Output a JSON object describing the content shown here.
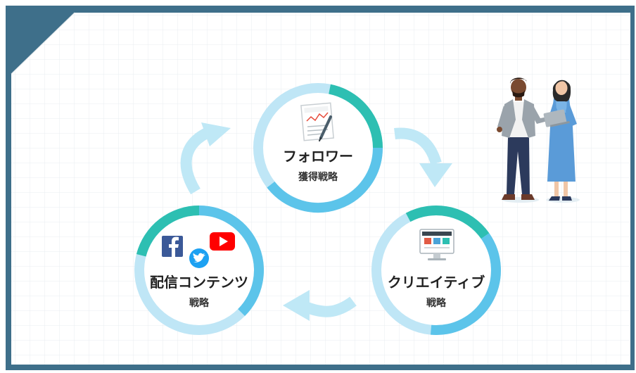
{
  "colors": {
    "teal": "#2dbfb2",
    "blue": "#5cc4ea",
    "light_blue": "#bfe6f6",
    "arrow": "#bfe8f6",
    "frame": "#3e6f8a",
    "grid": "#e9eef1"
  },
  "cycle": {
    "follower": {
      "title": "フォロワー",
      "subtitle": "獲得戦略",
      "icon": "document-pen-icon"
    },
    "creative": {
      "title": "クリエイティブ",
      "subtitle": "戦略",
      "icon": "monitor-icon"
    },
    "distribution": {
      "title": "配信コンテンツ",
      "subtitle": "戦略",
      "icons": [
        "facebook-icon",
        "twitter-icon",
        "youtube-icon"
      ]
    }
  },
  "illustration": "business-people-illustration"
}
